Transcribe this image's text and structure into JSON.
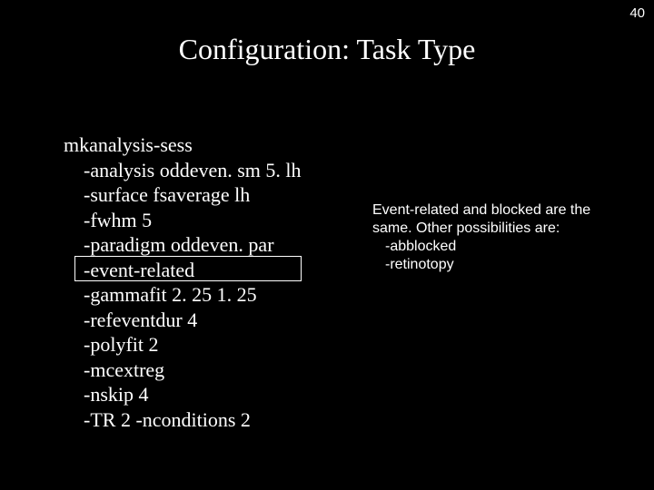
{
  "page_number": "40",
  "title": "Configuration: Task Type",
  "code": {
    "cmd": "mkanalysis-sess",
    "args": [
      "-analysis oddeven. sm 5. lh",
      "-surface fsaverage lh",
      "-fwhm 5",
      "-paradigm oddeven. par",
      "-event-related",
      "-gammafit 2. 25 1. 25",
      "-refeventdur 4",
      "-polyfit 2",
      "-mcextreg",
      "-nskip 4",
      "-TR 2 -nconditions 2"
    ],
    "highlighted_index": 4
  },
  "note": {
    "lead": "Event-related and blocked are the same. Other possibilities are:",
    "subs": [
      "-abblocked",
      "-retinotopy"
    ]
  }
}
